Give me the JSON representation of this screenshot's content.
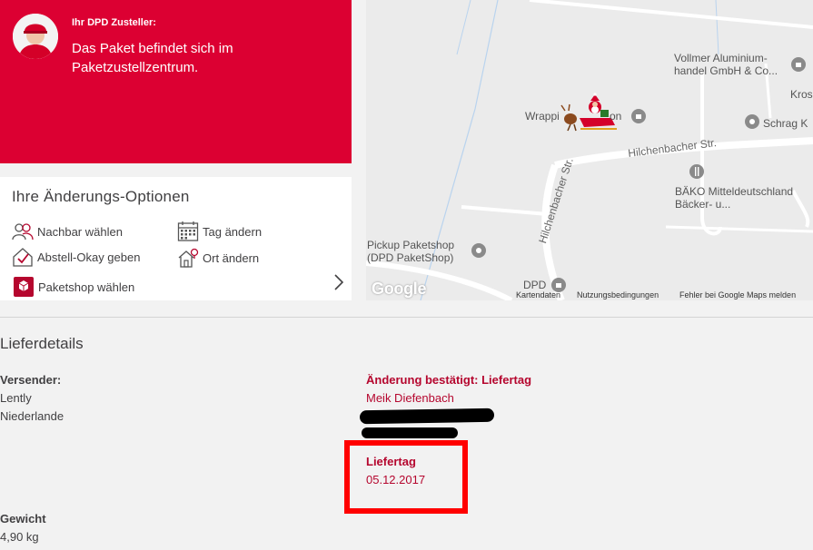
{
  "courier": {
    "heading": "Ihr DPD Zusteller:",
    "status": "Das Paket befindet sich im Paketzustellzentrum."
  },
  "options": {
    "title": "Ihre Änderungs-Optionen",
    "items": [
      {
        "label": "Nachbar wählen",
        "icon": "neighbors-icon"
      },
      {
        "label": "Tag ändern",
        "icon": "calendar-icon"
      },
      {
        "label": "Abstell-Okay geben",
        "icon": "drop-off-icon"
      },
      {
        "label": "Ort ändern",
        "icon": "house-icon"
      },
      {
        "label": "Paketshop wählen",
        "icon": "parcelshop-icon"
      }
    ]
  },
  "map": {
    "labels": {
      "vollmer": "Vollmer Aluminium-\nhandel GmbH & Co...",
      "kros": "Kros",
      "wrapp": "Wrappi",
      "wrapp2": "on",
      "schrag": "Schrag K",
      "hilchen1": "Hilchenbacher Str.",
      "hilchen2": "Hilchenbacher Str.",
      "baeko": "BÄKO Mitteldeutschland\nBäcker- u...",
      "pickup": "Pickup Paketshop\n(DPD PaketShop)",
      "dpd": "DPD"
    },
    "footer": {
      "logo": "Google",
      "kartendaten": "Kartendaten",
      "nutzung": "Nutzungsbedingungen",
      "fehler": "Fehler bei Google Maps melden"
    }
  },
  "details": {
    "title": "Lieferdetails",
    "sender_label": "Versender:",
    "sender_name": "Lently",
    "sender_country": "Niederlande",
    "change_label": "Änderung bestätigt: Liefertag",
    "recipient_name": "Meik Diefenbach",
    "delivery_day_label": "Liefertag",
    "delivery_day_value": "05.12.2017",
    "weight_label": "Gewicht",
    "weight_value": "4,90 kg"
  },
  "colors": {
    "brand_red": "#dc0032",
    "text_red": "#b5062e",
    "highlight": "#ff0000"
  }
}
